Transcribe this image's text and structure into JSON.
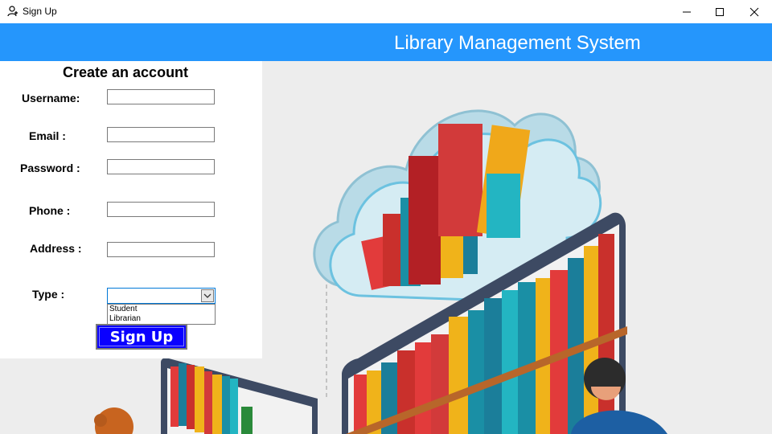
{
  "window": {
    "title": "Sign Up",
    "icon": "user-add-icon",
    "controls": [
      "minimize-icon",
      "maximize-icon",
      "close-icon"
    ]
  },
  "header": {
    "title": "Library Management System",
    "bg_color": "#2596fc"
  },
  "form": {
    "heading": "Create an account",
    "username_label": "Username:",
    "email_label": "Email :",
    "password_label": "Password :",
    "phone_label": "Phone :",
    "address_label": "Address :",
    "type_label": "Type :",
    "type_value": "",
    "type_options": [
      "Student",
      "Librarian"
    ],
    "submit_label": "Sign Up",
    "submit_color": "#0a00ff"
  }
}
